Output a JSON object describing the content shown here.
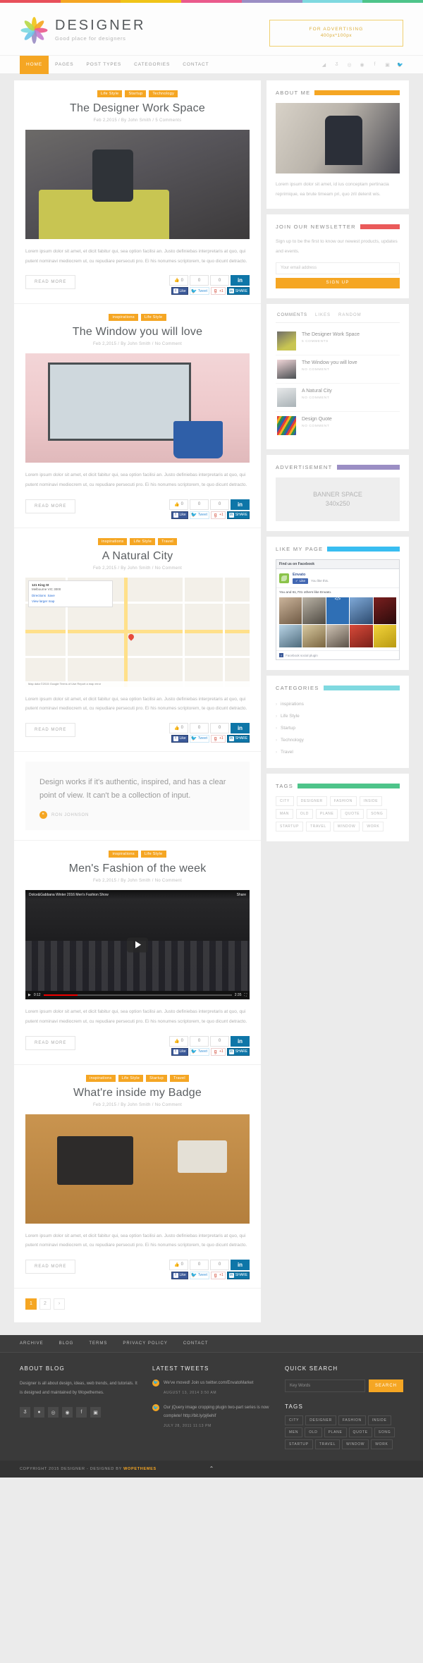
{
  "brand": {
    "title": "DESIGNER",
    "tagline": "Good place for designers",
    "ad_line1": "FOR ADVERTISING",
    "ad_line2": "400px*100px"
  },
  "nav": {
    "items": [
      {
        "label": "HOME",
        "active": true
      },
      {
        "label": "PAGES",
        "active": false
      },
      {
        "label": "POST TYPES",
        "active": false
      },
      {
        "label": "CATEGORIES",
        "active": false
      },
      {
        "label": "CONTACT",
        "active": false
      }
    ],
    "social": [
      "rss-icon",
      "behance-icon",
      "dribbble-icon",
      "pinterest-icon",
      "facebook-icon",
      "flickr-icon",
      "twitter-icon"
    ]
  },
  "share": {
    "facebook_count": "0",
    "twitter_count": "0",
    "google_count": "0",
    "linkedin_icon": "in",
    "fb_label": "Like",
    "tw_label": "Tweet",
    "gp_label": "+1",
    "li_label": "SHARE",
    "read_more": "READ MORE"
  },
  "posts": [
    {
      "categories": [
        "Life Style",
        "Startup",
        "Technology"
      ],
      "title": "The Designer Work Space",
      "meta": "Feb 2,2015 / By John Smith / 5 Comments",
      "excerpt": "Lorem ipsum dolor sit amet, et dicit fabitur qui, sea option facilisi an. Justo definiebas interpretaris at quo, qui putent nominavi mediocrem ut, cu repudiare persecuti pro. Ei his nonumes scriptorem, te quo dicunt detracto.",
      "media": "image-workspace"
    },
    {
      "categories": [
        "inspirations",
        "Life Style"
      ],
      "title": "The Window you will love",
      "meta": "Feb 2,2015 / By John Smith / No Comment",
      "excerpt": "Lorem ipsum dolor sit amet, et dicit fabitur qui, sea option facilisi an. Justo definiebas interpretaris at quo, qui putent nominavi mediocrem ut, cu repudiare persecuti pro. Ei his nonumes scriptorem, te quo dicunt detracto.",
      "media": "image-window"
    },
    {
      "categories": [
        "inspirations",
        "Life Style",
        "Travel"
      ],
      "title": "A Natural City",
      "meta": "Feb 2,2015 / By John Smith / No Comment",
      "excerpt": "Lorem ipsum dolor sit amet, et dicit fabitur qui, sea option facilisi an. Justo definiebas interpretaris at quo, qui putent nominavi mediocrem ut, cu repudiare persecuti pro. Ei his nonumes scriptorem, te quo dicunt detracto.",
      "media": "map",
      "map": {
        "address_title": "121 King St",
        "address_sub": "Melbourne VIC 3000",
        "directions": "Directions",
        "save": "Save",
        "view_larger": "View larger map",
        "pin_label": "121 King St",
        "footer": "Map data ©2015 Google   Terms of Use   Report a map error"
      }
    },
    {
      "type": "quote",
      "text": "Design works if it's authentic, inspired, and has a clear point of view. It can't be a collection of input.",
      "author": "RON JOHNSON"
    },
    {
      "categories": [
        "inspirations",
        "Life Style"
      ],
      "title": "Men's Fashion of the week",
      "meta": "Feb 2,2015 / By John Smith / No Comment",
      "excerpt": "Lorem ipsum dolor sit amet, et dicit fabitur qui, sea option facilisi an. Justo definiebas interpretaris at quo, qui putent nominavi mediocrem ut, cu repudiare persecuti pro. Ei his nonumes scriptorem, te quo dicunt detracto.",
      "media": "video",
      "video": {
        "title": "Dolce&Gabbana Winter 2016 Men's Fashion Show",
        "share_label": "Share",
        "time_current": "0:12",
        "time_total": "2:35"
      }
    },
    {
      "categories": [
        "inspirations",
        "Life Style",
        "Startup",
        "Travel"
      ],
      "title": "What're inside my Badge",
      "meta": "Feb 2,2015 / By John Smith / No Comment",
      "excerpt": "Lorem ipsum dolor sit amet, et dicit fabitur qui, sea option facilisi an. Justo definiebas interpretaris at quo, qui putent nominavi mediocrem ut, cu repudiare persecuti pro. Ei his nonumes scriptorem, te quo dicunt detracto.",
      "media": "image-badge"
    }
  ],
  "pagination": {
    "pages": [
      "1",
      "2",
      "›"
    ],
    "current": "1"
  },
  "sidebar": {
    "about": {
      "title": "ABOUT ME",
      "rule_color": "#f5a623",
      "text": "Lorem ipsum dolor sit amet, id ius conceptam pertinacia reprimique, ea brute timeam pri, quo zril delenit wis."
    },
    "newsletter": {
      "title": "JOIN OUR NEWSLETTER",
      "rule_color": "#ea5a5a",
      "text": "Sign up to be the first to know our newest products, updates and events.",
      "placeholder": "Your email address",
      "button": "SIGN UP"
    },
    "tabs_widget": {
      "tabs": [
        "COMMENTS",
        "LIKES",
        "RANDOM"
      ],
      "active_tab": "COMMENTS",
      "items": [
        {
          "title": "The Designer Work Space",
          "meta": "5 COMMENTS",
          "thumb": "thumb-a"
        },
        {
          "title": "The Window you will love",
          "meta": "NO COMMENT",
          "thumb": "thumb-b"
        },
        {
          "title": "A Natural City",
          "meta": "NO COMMENT",
          "thumb": "thumb-c"
        },
        {
          "title": "Design Quote",
          "meta": "NO COMMENT",
          "thumb": "thumb-d"
        }
      ]
    },
    "advertisement": {
      "title": "ADVERTISEMENT",
      "rule_color": "#9b8ec4",
      "banner_line1": "BANNER SPACE",
      "banner_line2": "340x250"
    },
    "like_page": {
      "title": "LIKE MY PAGE",
      "rule_color": "#38bdf1",
      "fb_header": "Find us on Facebook",
      "fb_page_name": "Envato",
      "fb_like_button": "Like",
      "fb_like_state": "You like this.",
      "fb_social_proof": "You and 61,701 others like Envato.",
      "fb_footer": "Facebook social plugin"
    },
    "categories": {
      "title": "CATEGORIES",
      "rule_color": "#7fd9e0",
      "items": [
        "inspirations",
        "Life Style",
        "Startup",
        "Technology",
        "Travel"
      ]
    },
    "tags": {
      "title": "TAGS",
      "rule_color": "#4ec48a",
      "items": [
        "CITY",
        "DESIGNER",
        "FASHION",
        "INSIDE",
        "MAN",
        "OLD",
        "PLANE",
        "QUOTE",
        "SONG",
        "STARTUP",
        "TRAVEL",
        "WINDOW",
        "WORK"
      ]
    }
  },
  "footer": {
    "nav": [
      "ARCHIVE",
      "BLOG",
      "TERMS",
      "PRIVACY POLICY",
      "CONTACT"
    ],
    "about": {
      "title": "ABOUT BLOG",
      "text": "Designer is all about design, ideas, web trends, and tutorials. It is designed and maintained by Wopethemes.",
      "social": [
        "behance-icon",
        "dribbble-icon",
        "pinterest-icon",
        "flickr-icon",
        "facebook-icon",
        "instagram-icon"
      ]
    },
    "tweets": {
      "title": "LATEST TWEETS",
      "items": [
        {
          "text": "We've moved! Join us twitter.com/EnvatoMarket",
          "date": "AUGUST 13, 2014 3:50 AM"
        },
        {
          "text": "Our jQuery image cropping plugin two-part series is now complete! http://bit.ly/pj6ehif",
          "date": "JULY 28, 2011 11:13 PM"
        }
      ]
    },
    "search": {
      "title": "QUICK SEARCH",
      "placeholder": "Key Words",
      "button": "SEARCH"
    },
    "tags": {
      "title": "TAGS",
      "items": [
        "CITY",
        "DESIGNER",
        "FASHION",
        "INSIDE",
        "MEN",
        "OLD",
        "PLANE",
        "QUOTE",
        "SONG",
        "STARTUP",
        "TRAVEL",
        "WINDOW",
        "WORK"
      ]
    },
    "copyright_prefix": "COPYRIGHT 2015 DESIGNER - DESIGNED BY ",
    "copyright_brand": "WOPETHEMES",
    "to_top": "⌃"
  },
  "colors": {
    "accent": "#f5a623",
    "rainbow": [
      "#e8505b",
      "#f5a623",
      "#f0c419",
      "#ea5a8c",
      "#9b8ec4",
      "#7fd9e0",
      "#4ec48a"
    ]
  }
}
